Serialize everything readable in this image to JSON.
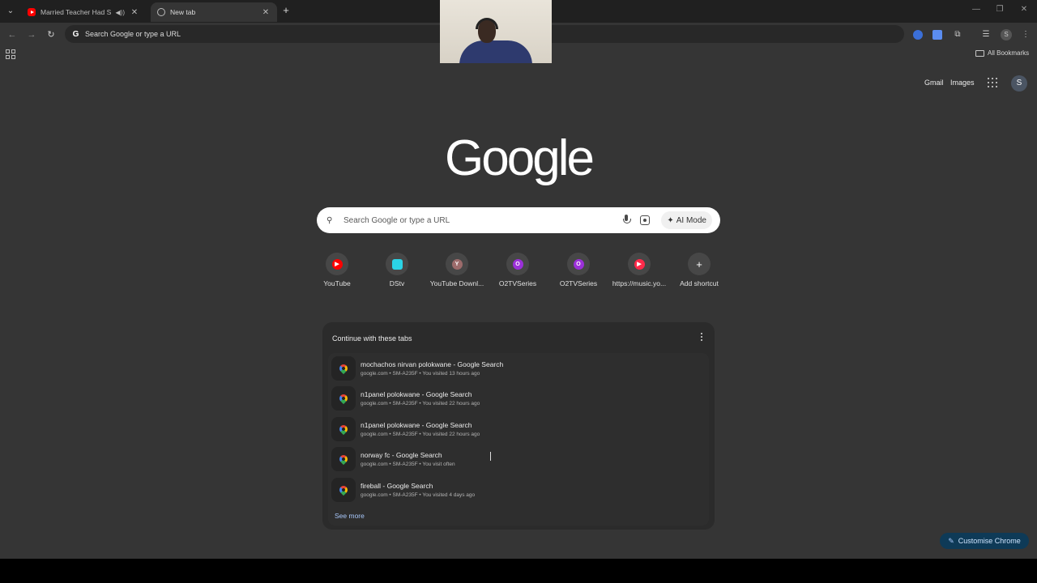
{
  "tabs": [
    {
      "title": "Married Teacher Had Sex W",
      "audio": "◀))",
      "close": "✕"
    },
    {
      "title": "New tab",
      "close": "✕"
    }
  ],
  "tab_search_glyph": "⌄",
  "new_tab_glyph": "+",
  "window_controls": {
    "minimize": "—",
    "restore": "❐",
    "close": "✕"
  },
  "toolbar": {
    "back": "←",
    "forward": "→",
    "reload": "↻",
    "omnibox_text": "Search Google or type a URL",
    "google_glyph": "G",
    "extensions_glyph": "⧉",
    "reading_glyph": "☰",
    "avatar_letter": "S",
    "menu_glyph": "⋮"
  },
  "bookmarks_bar": {
    "all_bookmarks": "All Bookmarks"
  },
  "header": {
    "gmail": "Gmail",
    "images": "Images",
    "avatar_letter": "S"
  },
  "logo": "Google",
  "search": {
    "placeholder": "Search Google or type a URL",
    "ai_mode": "AI Mode",
    "search_glyph": "🔍",
    "ai_glyph": "✦"
  },
  "shortcuts": [
    {
      "label": "YouTube",
      "glyph": "▶",
      "color": "#ff0000"
    },
    {
      "label": "DStv",
      "glyph": "",
      "color": "#2bd4e6"
    },
    {
      "label": "YouTube Downl...",
      "glyph": "Y",
      "color": "#9c6b6b"
    },
    {
      "label": "O2TVSeries",
      "glyph": "O",
      "color": "#9b30d9"
    },
    {
      "label": "O2TVSeries",
      "glyph": "O",
      "color": "#9b30d9"
    },
    {
      "label": "https://music.yo...",
      "glyph": "▶",
      "color": "#ff2a4a"
    },
    {
      "label": "Add shortcut",
      "glyph": "+",
      "color": "#474747"
    }
  ],
  "continue": {
    "title": "Continue with these tabs",
    "see_more": "See more",
    "rows": [
      {
        "title": "mochachos nirvan polokwane - Google Search",
        "sub": "google.com • SM-A235F • You visited 13 hours ago"
      },
      {
        "title": "n1panel polokwane - Google Search",
        "sub": "google.com • SM-A235F • You visited 22 hours ago"
      },
      {
        "title": "n1panel polokwane - Google Search",
        "sub": "google.com • SM-A235F • You visited 22 hours ago"
      },
      {
        "title": "norway fc - Google Search",
        "sub": "google.com • SM-A235F • You visit often"
      },
      {
        "title": "fireball - Google Search",
        "sub": "google.com • SM-A235F • You visited 4 days ago"
      }
    ]
  },
  "customise": {
    "label": "Customise Chrome",
    "glyph": "✎"
  }
}
